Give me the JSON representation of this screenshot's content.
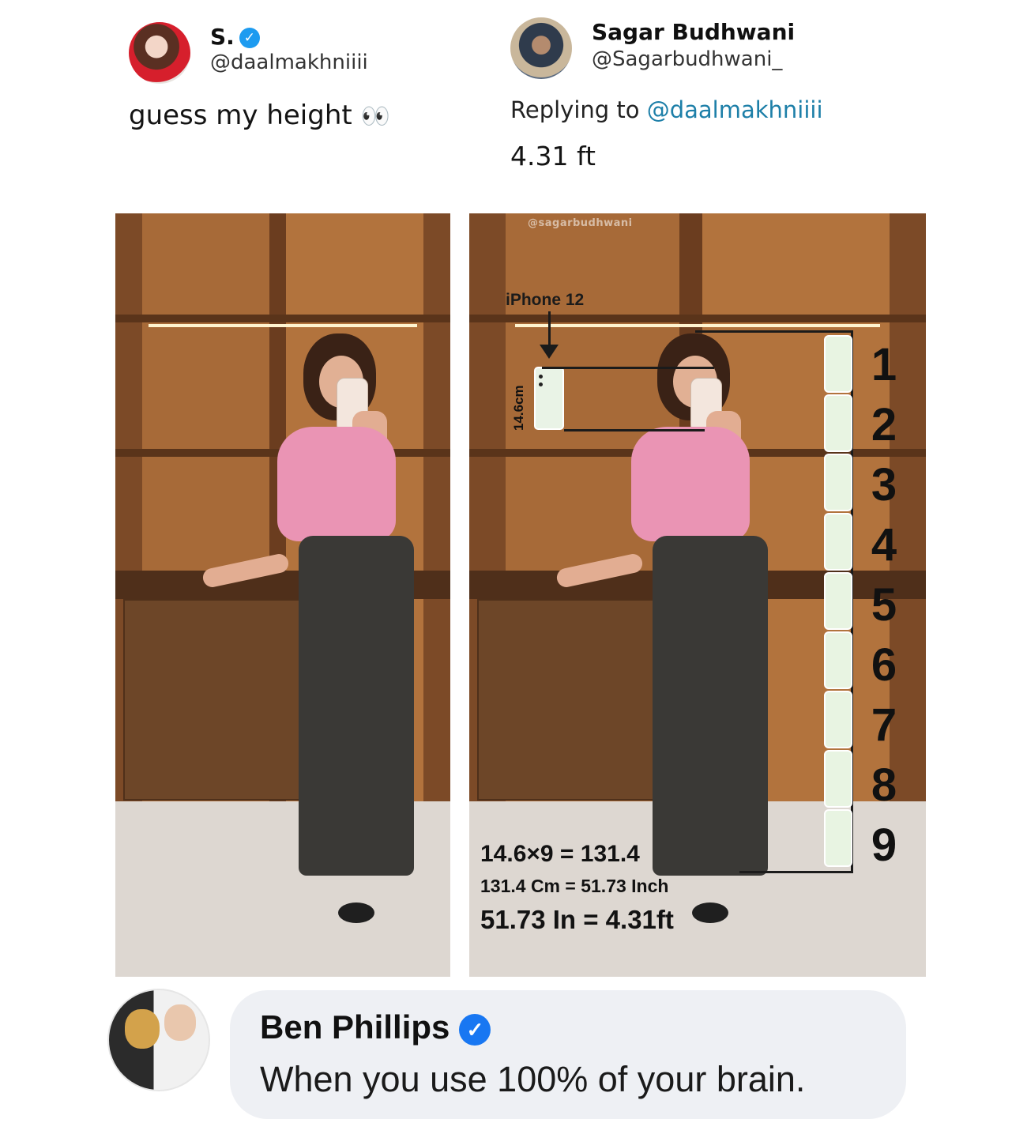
{
  "tweet1": {
    "name": "S.",
    "handle": "@daalmakhniiii",
    "text": "guess my height",
    "emoji": "👀",
    "verified_icon": "✓"
  },
  "tweet2": {
    "name": "Sagar Budhwani",
    "handle": "@Sagarbudhwani_",
    "replying_prefix": "Replying to",
    "replying_handle": "@daalmakhniiii",
    "text": "4.31 ft"
  },
  "annotation": {
    "watermark": "@sagarbudhwani",
    "iphone_label": "iPhone 12",
    "phone_height": "14.6cm",
    "stack_numbers": [
      "1",
      "2",
      "3",
      "4",
      "5",
      "6",
      "7",
      "8",
      "9"
    ],
    "calc_line1": "14.6×9 = 131.4",
    "calc_line2": "131.4 Cm = 51.73 Inch",
    "calc_line3": "51.73 In = 4.31ft"
  },
  "comment": {
    "name": "Ben Phillips",
    "text": "When you use 100% of your brain.",
    "verified_icon": "✓"
  },
  "colors": {
    "verified_blue": "#1d9bf0",
    "link": "#1d7fa8",
    "bubble": "#eef0f4"
  }
}
